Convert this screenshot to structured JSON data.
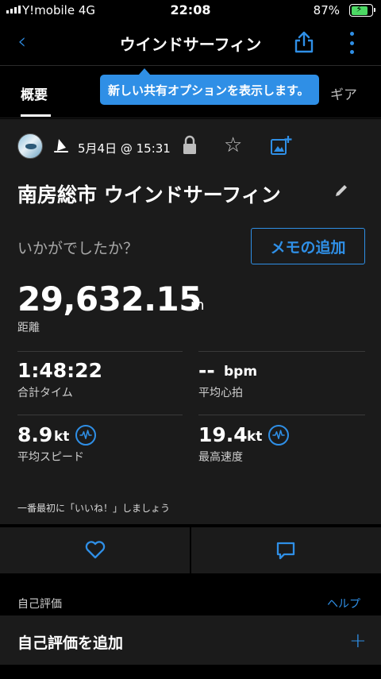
{
  "status_bar": {
    "carrier": "Y!mobile  4G",
    "time": "22:08",
    "battery": "87%"
  },
  "nav": {
    "title": "ウインドサーフィン",
    "back_icon": "chevron-left-icon",
    "share_icon": "share-icon",
    "more_icon": "more-vertical-icon"
  },
  "tabs": {
    "overview": "概要",
    "gear": "ギア"
  },
  "tooltip": "新しい共有オプションを表示します。",
  "activity": {
    "date": "5月4日 @ 15:31",
    "title": "南房総市 ウインドサーフィン",
    "prompt": "いかがでしたか？",
    "memo_button": "メモの追加"
  },
  "stats": {
    "distance": {
      "value": "29,632.15",
      "unit": "m",
      "label": "距離"
    },
    "total_time": {
      "value": "1:48:22",
      "label": "合計タイム"
    },
    "avg_hr": {
      "value": "--",
      "unit": "bpm",
      "label": "平均心拍"
    },
    "avg_speed": {
      "value": "8.9",
      "unit": "kt",
      "label": "平均スピード"
    },
    "max_speed": {
      "value": "19.4",
      "unit": "kt",
      "label": "最高速度"
    }
  },
  "like_prompt": "一番最初に「いいね！」しましょう",
  "self_eval": {
    "label": "自己評価",
    "help": "ヘルプ",
    "add": "自己評価を追加"
  },
  "colors": {
    "accent": "#2f8fe6",
    "background": "#000000",
    "card": "#1b1b1b",
    "battery": "#4cd964"
  }
}
